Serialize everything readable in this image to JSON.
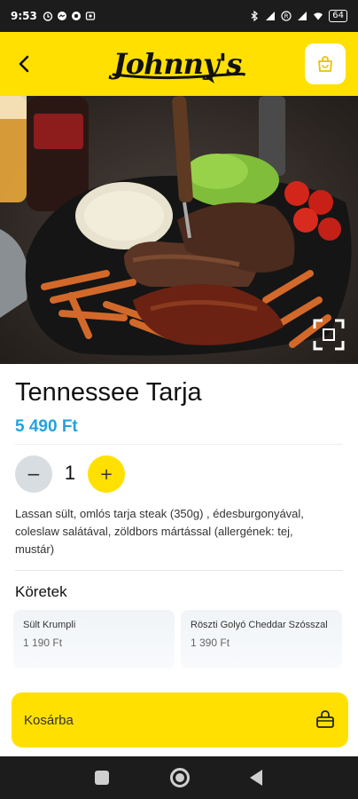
{
  "status_bar": {
    "time": "9:53",
    "battery": "64",
    "left_icons": [
      "alarm-icon",
      "messenger-icon",
      "record-icon",
      "gallery-icon"
    ],
    "right_icons": [
      "bluetooth-icon",
      "signal-icon",
      "roaming-icon",
      "signal-icon",
      "wifi-icon",
      "battery-icon"
    ]
  },
  "header": {
    "back_icon": "back-arrow-icon",
    "logo": "Johnny's",
    "cart_icon": "shopping-bag-icon",
    "accent_color": "#ffe000"
  },
  "product": {
    "image_alt": "food photo",
    "title": "Tennessee Tarja",
    "price": "5 490 Ft",
    "price_color": "#23a3dd",
    "quantity": {
      "minus": "−",
      "value": "1",
      "plus": "+"
    },
    "description": "Lassan sült, omlós tarja steak (350g) , édesburgonyával, coleslaw salátával, zöldbors mártással (allergének: tej, mustár)"
  },
  "sides": {
    "title": "Köretek",
    "items": [
      {
        "name": "Sült Krumpli",
        "price": "1 190 Ft"
      },
      {
        "name": "Röszti Golyó Cheddar Szósszal",
        "price": "1 390 Ft"
      }
    ]
  },
  "add_to_cart": {
    "label": "Kosárba",
    "icon": "basket-icon"
  },
  "nav_bar": {
    "buttons": [
      "recents-button",
      "home-button",
      "back-button"
    ]
  }
}
